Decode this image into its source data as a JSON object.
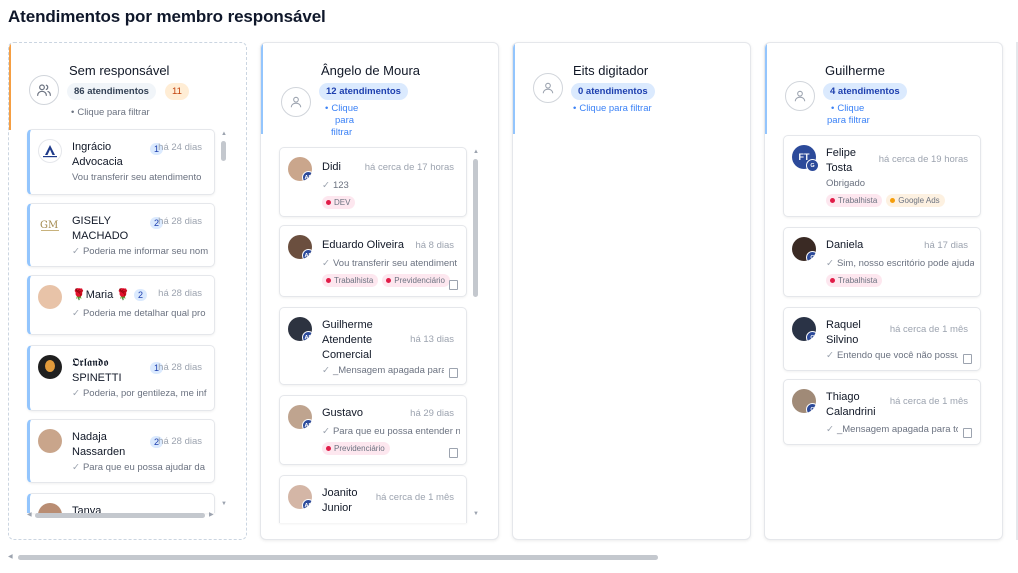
{
  "page": {
    "title": "Atendimentos por membro responsável"
  },
  "colors": {
    "accent_blue": "#93c5fd",
    "accent_orange": "#f59e42",
    "badge_blue": "#dbeafe",
    "link": "#3b82f6"
  },
  "columns": [
    {
      "name": "Sem responsável",
      "count": "86 atendimentos",
      "extra_badge": "11",
      "filter": "Clique para filtrar",
      "icon": "users-icon",
      "cards": [
        {
          "name": "Ingrácio Advocacia",
          "badge": "1",
          "time": "há 24 dias",
          "message": "Vou transferir seu atendimento"
        },
        {
          "name": "GISELY MACHADO",
          "badge": "2",
          "time": "há 28 dias",
          "message": "Poderia me informar seu nom"
        },
        {
          "name": "🌹Maria 🌹",
          "badge": "2",
          "time": "há 28 dias",
          "message": "Poderia me detalhar qual pro"
        },
        {
          "name": "𝕺𝖗𝖑𝖆𝖓𝖉𝖔 SPINETTI",
          "badge": "1",
          "time": "há 28 dias",
          "message": "Poderia, por gentileza, me inf"
        },
        {
          "name": "Nadaja Nassarden",
          "badge": "2",
          "time": "há 28 dias",
          "message": "Para que eu possa ajudar da"
        },
        {
          "name": "Tanya"
        }
      ]
    },
    {
      "name": "Ângelo de Moura",
      "count": "12 atendimentos",
      "filter": "Clique para filtrar",
      "filter_lines": [
        "Clique",
        "para",
        "filtrar"
      ],
      "cards": [
        {
          "name": "Didi",
          "time": "há cerca de 17 horas",
          "message": "123",
          "tags": [
            {
              "label": "DEV",
              "kind": "rose"
            }
          ],
          "avatar_tag": "AD"
        },
        {
          "name": "Eduardo Oliveira",
          "time": "há 8 dias",
          "message": "Vou transferir seu atendiment",
          "tags": [
            {
              "label": "Trabalhista",
              "kind": "rose"
            },
            {
              "label": "Previdenciário",
              "kind": "rose"
            }
          ],
          "avatar_tag": "AD"
        },
        {
          "name": "Guilherme Atendente Comercial",
          "time": "há 13 dias",
          "message": "_Mensagem apagada para",
          "avatar_tag": "AD"
        },
        {
          "name": "Gustavo",
          "time": "há 29 dias",
          "message": "Para que eu possa entender n",
          "tags": [
            {
              "label": "Previdenciário",
              "kind": "rose"
            }
          ],
          "avatar_tag": "AD"
        },
        {
          "name": "Joanito Junior",
          "time": "há cerca de 1 mês",
          "avatar_tag": "AD"
        }
      ]
    },
    {
      "name": "Eits digitador",
      "count": "0 atendimentos",
      "filter": "Clique para filtrar",
      "cards": []
    },
    {
      "name": "Guilherme",
      "count": "4 atendimentos",
      "filter_lines": [
        "Clique",
        "para filtrar"
      ],
      "cards": [
        {
          "name": "Felipe Tosta",
          "time": "há cerca de 19 horas",
          "message": "Obrigado",
          "tags": [
            {
              "label": "Trabalhista",
              "kind": "rose"
            },
            {
              "label": "Google Ads",
              "kind": "amber"
            }
          ],
          "avatar_tag": "G",
          "initials": "FT"
        },
        {
          "name": "Daniela",
          "time": "há 17 dias",
          "message": "Sim, nosso escritório pode ajuda",
          "tags": [
            {
              "label": "Trabalhista",
              "kind": "rose"
            }
          ],
          "avatar_tag": "G"
        },
        {
          "name": "Raquel Silvino",
          "time": "há cerca de 1 mês",
          "message": "Entendo que você não possu",
          "avatar_tag": "G"
        },
        {
          "name": "Thiago Calandrini",
          "time": "há cerca de 1 mês",
          "message": "_Mensagem apagada para to",
          "avatar_tag": "G"
        }
      ]
    }
  ]
}
